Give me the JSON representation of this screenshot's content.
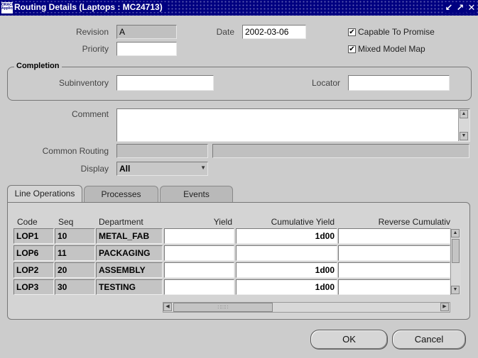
{
  "window": {
    "title": "Routing Details (Laptops : MC24713)",
    "icon_text": "ORACLE Applications",
    "min_glyph": "↙",
    "max_glyph": "↗",
    "close_glyph": "✕"
  },
  "header": {
    "revision_label": "Revision",
    "revision_value": "A",
    "date_label": "Date",
    "date_value": "2002-03-06",
    "priority_label": "Priority",
    "priority_value": "",
    "capable_to_promise_label": "Capable To Promise",
    "capable_to_promise_checked": true,
    "mixed_model_map_label": "Mixed Model Map",
    "mixed_model_map_checked": true,
    "check_glyph": "✔"
  },
  "completion": {
    "title": "Completion",
    "subinventory_label": "Subinventory",
    "subinventory_value": "",
    "locator_label": "Locator",
    "locator_value": ""
  },
  "comment": {
    "label": "Comment",
    "value": ""
  },
  "common_routing": {
    "label": "Common Routing",
    "value1": "",
    "value2": ""
  },
  "display": {
    "label": "Display",
    "value": "All",
    "arrow": "▼"
  },
  "tabs": [
    {
      "label": "Line Operations",
      "active": true
    },
    {
      "label": "Processes",
      "active": false
    },
    {
      "label": "Events",
      "active": false
    }
  ],
  "table": {
    "columns": [
      "Code",
      "Seq",
      "Department",
      "Yield",
      "Cumulative Yield",
      "Reverse Cumulativ"
    ],
    "rows": [
      {
        "code": "LOP1",
        "seq": "10",
        "department": "METAL_FAB",
        "yield": "",
        "cumulative_yield": "1d00",
        "reverse_cumulative": ""
      },
      {
        "code": "LOP6",
        "seq": "11",
        "department": "PACKAGING",
        "yield": "",
        "cumulative_yield": "",
        "reverse_cumulative": ""
      },
      {
        "code": "LOP2",
        "seq": "20",
        "department": "ASSEMBLY",
        "yield": "",
        "cumulative_yield": "1d00",
        "reverse_cumulative": ""
      },
      {
        "code": "LOP3",
        "seq": "30",
        "department": "TESTING",
        "yield": "",
        "cumulative_yield": "1d00",
        "reverse_cumulative": ""
      }
    ]
  },
  "scroll": {
    "up": "▲",
    "down": "▼",
    "left": "◀",
    "right": "▶",
    "thumb_grip": "∷∷∷"
  },
  "buttons": {
    "ok": "OK",
    "cancel": "Cancel"
  }
}
